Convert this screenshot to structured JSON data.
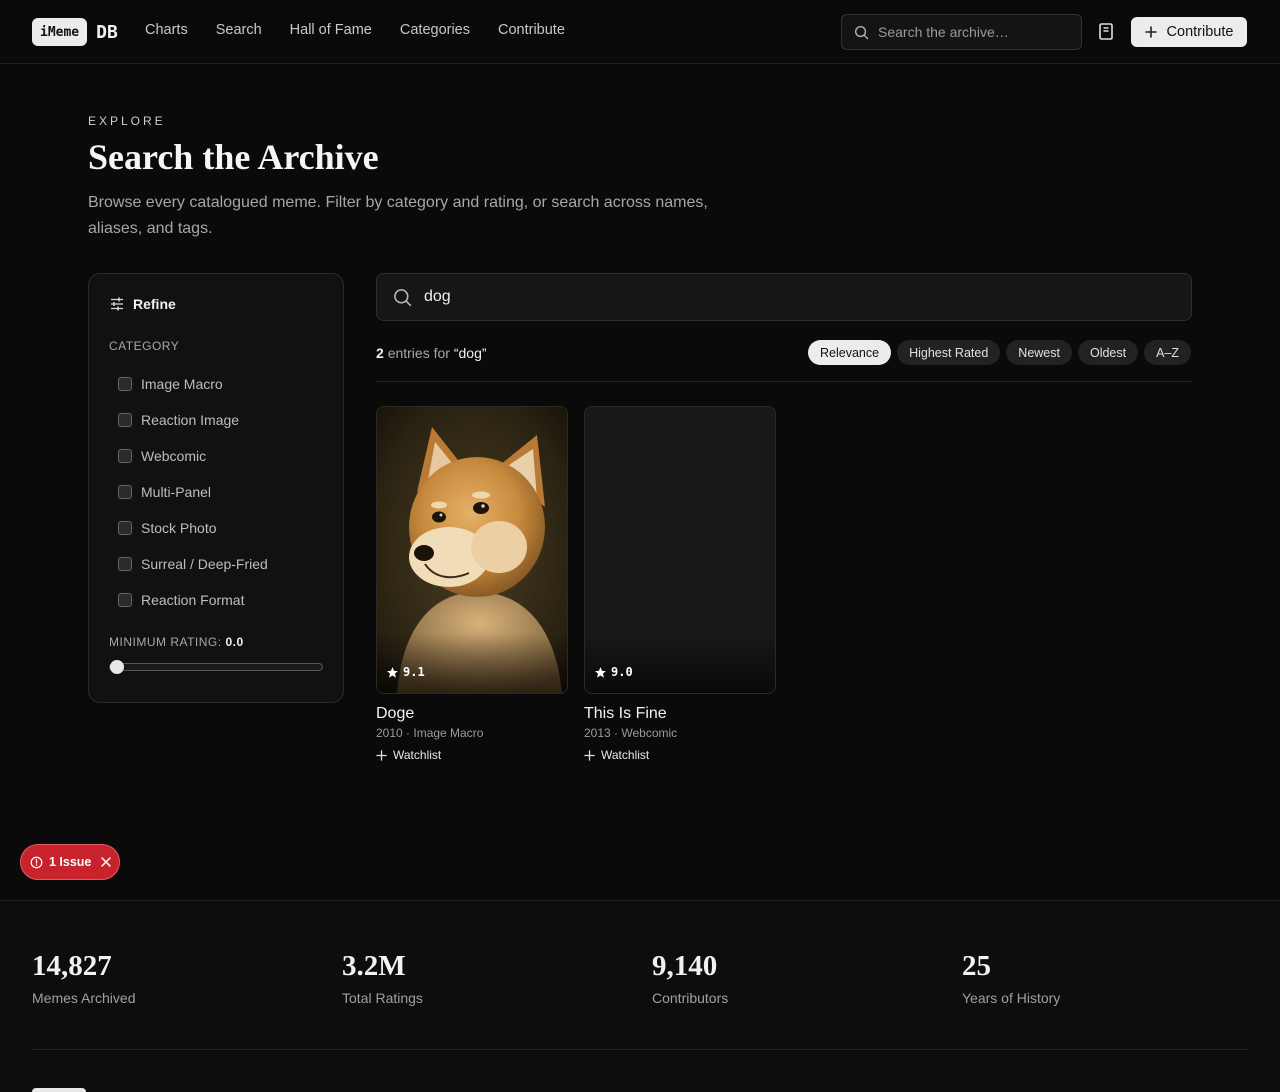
{
  "brand": {
    "badge": "iMeme",
    "suffix": "DB"
  },
  "nav": {
    "items": [
      {
        "label": "Charts"
      },
      {
        "label": "Search"
      },
      {
        "label": "Hall of Fame"
      },
      {
        "label": "Categories"
      },
      {
        "label": "Contribute"
      }
    ],
    "search_placeholder": "Search the archive…",
    "contribute_label": "Contribute"
  },
  "hero": {
    "eyebrow": "EXPLORE",
    "title": "Search the Archive",
    "subtitle": "Browse every catalogued meme. Filter by category and rating, or search across names, aliases, and tags."
  },
  "refine": {
    "title": "Refine",
    "category_label": "CATEGORY",
    "categories": [
      {
        "label": "Image Macro",
        "checked": false
      },
      {
        "label": "Reaction Image",
        "checked": false
      },
      {
        "label": "Webcomic",
        "checked": false
      },
      {
        "label": "Multi-Panel",
        "checked": false
      },
      {
        "label": "Stock Photo",
        "checked": false
      },
      {
        "label": "Surreal / Deep-Fried",
        "checked": false
      },
      {
        "label": "Reaction Format",
        "checked": false
      }
    ],
    "min_rating_label": "MINIMUM RATING:",
    "min_rating_value": "0.0",
    "min_rating_fraction": 0
  },
  "search": {
    "query": "dog",
    "result_count": "2",
    "result_text": "entries for",
    "result_query_display": "“dog”",
    "sort_options": [
      {
        "label": "Relevance",
        "active": true
      },
      {
        "label": "Highest Rated",
        "active": false
      },
      {
        "label": "Newest",
        "active": false
      },
      {
        "label": "Oldest",
        "active": false
      },
      {
        "label": "A–Z",
        "active": false
      }
    ]
  },
  "results": [
    {
      "title": "Doge",
      "meta": "2010 · Image Macro",
      "rating": "9.1",
      "watchlist_label": "Watchlist",
      "has_image": true
    },
    {
      "title": "This Is Fine",
      "meta": "2013 · Webcomic",
      "rating": "9.0",
      "watchlist_label": "Watchlist",
      "has_image": false
    }
  ],
  "issue_badge": {
    "label": "1 Issue"
  },
  "stats": [
    {
      "value": "14,827",
      "label": "Memes Archived"
    },
    {
      "value": "3.2M",
      "label": "Total Ratings"
    },
    {
      "value": "9,140",
      "label": "Contributors"
    },
    {
      "value": "25",
      "label": "Years of History"
    }
  ],
  "colors": {
    "background": "#0a0a0a",
    "accent_light": "#ececec",
    "issue_red": "#c8232c"
  }
}
